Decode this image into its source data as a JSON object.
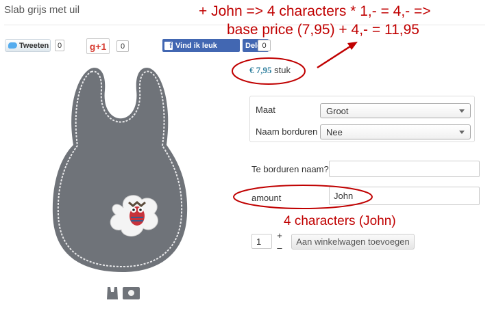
{
  "product": {
    "title": "Slab grijs met uil"
  },
  "social": {
    "tweet_label": "Tweeten",
    "tweet_count": "0",
    "gplus_label": "g+1",
    "gplus_count": "0",
    "fb_like_label": "Vind ik leuk",
    "fb_share_label": "Delen",
    "fb_count": "0"
  },
  "price": {
    "amount": "€ 7,95",
    "unit": "stuk"
  },
  "options": {
    "size_label": "Maat",
    "size_value": "Groot",
    "embroidery_label": "Naam borduren",
    "embroidery_value": "Nee"
  },
  "form": {
    "name_label": "Te borduren naam?",
    "name_value": "",
    "amount_label": "amount",
    "amount_value": "John"
  },
  "cart": {
    "quantity": "1",
    "plus": "+",
    "minus": "–",
    "add_label": "Aan winkelwagen toevoegen"
  },
  "annotations": {
    "line1": "+ John => 4 characters * 1,- = 4,- =>",
    "line2": "base price (7,95) + 4,- = 11,95",
    "note": "4 characters (John)",
    "color": "#c00000"
  },
  "colors": {
    "facebook": "#4267b2",
    "twitter": "#55acee",
    "gplus": "#d73d32",
    "price": "#2f7f9e",
    "bib": "#6f7379"
  }
}
